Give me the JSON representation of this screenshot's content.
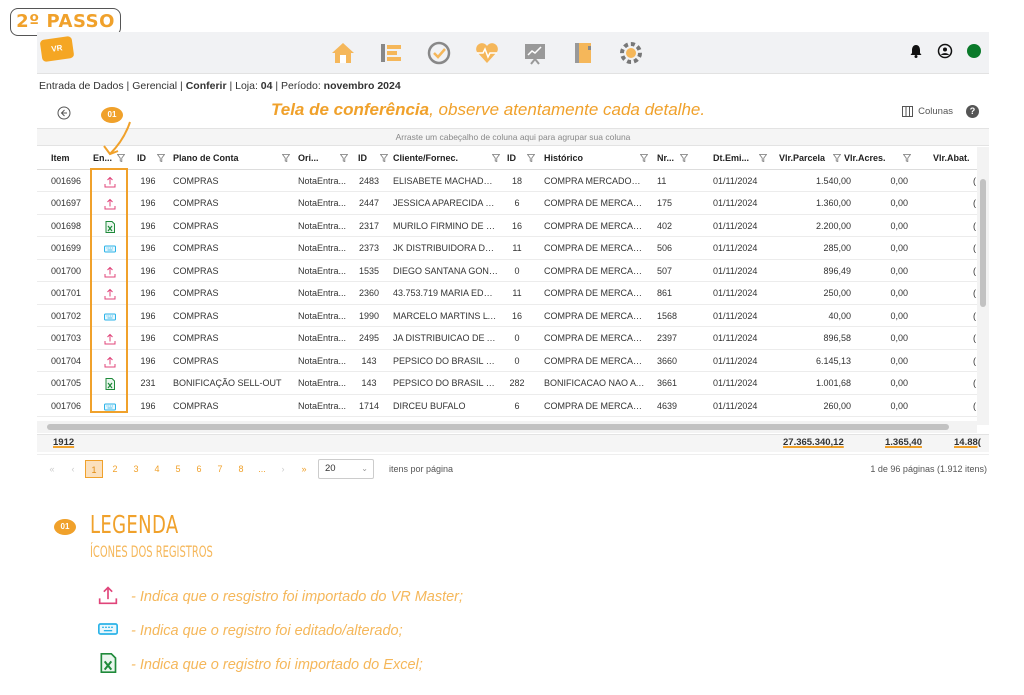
{
  "step_badge": "2º PASSO",
  "logo_text": "VR",
  "breadcrumb": {
    "part1": "Entrada de Dados | Gerencial | ",
    "module": "Conferir",
    "part2": " | Loja: ",
    "store": "04",
    "part3": " | Período: ",
    "period": "novembro 2024"
  },
  "headline": {
    "bold": "Tela de conferência",
    "rest": ", observe atentamente cada detalhe."
  },
  "columns_label": "Colunas",
  "help_label": "?",
  "group_bar_text": "Arraste um cabeçalho de coluna aqui para agrupar sua coluna",
  "callout_badge": "01",
  "grid": {
    "headers": [
      "Item",
      "En...",
      "ID",
      "Plano de Conta",
      "Ori...",
      "ID",
      "Cliente/Fornec.",
      "ID",
      "Histórico",
      "Nr...",
      "Dt.Emi...",
      "Vlr.Parcela",
      "Vlr.Acres.",
      "Vlr.Abat."
    ],
    "rows": [
      {
        "item": "001696",
        "icon": "upload-icon",
        "id1": "196",
        "plano": "COMPRAS",
        "ori": "NotaEntra...",
        "id2": "2483",
        "cliente": "ELISABETE MACHADO D...",
        "id3": "18",
        "historico": "COMPRA MERCADORIA...",
        "nr": "11",
        "dt": "01/11/2024",
        "parcela": "1.540,00",
        "acres": "0,00"
      },
      {
        "item": "001697",
        "icon": "upload-icon",
        "id1": "196",
        "plano": "COMPRAS",
        "ori": "NotaEntra...",
        "id2": "2447",
        "cliente": "JESSICA APARECIDA PER...",
        "id3": "6",
        "historico": "COMPRA DE MERCADO...",
        "nr": "175",
        "dt": "01/11/2024",
        "parcela": "1.360,00",
        "acres": "0,00"
      },
      {
        "item": "001698",
        "icon": "excel-icon",
        "id1": "196",
        "plano": "COMPRAS",
        "ori": "NotaEntra...",
        "id2": "2317",
        "cliente": "MURILO FIRMINO DE OL...",
        "id3": "16",
        "historico": "COMPRA DE MERCADO...",
        "nr": "402",
        "dt": "01/11/2024",
        "parcela": "2.200,00",
        "acres": "0,00"
      },
      {
        "item": "001699",
        "icon": "keyboard-icon",
        "id1": "196",
        "plano": "COMPRAS",
        "ori": "NotaEntra...",
        "id2": "2373",
        "cliente": "JK DISTRIBUIDORA DE H...",
        "id3": "11",
        "historico": "COMPRA DE MERCADO...",
        "nr": "506",
        "dt": "01/11/2024",
        "parcela": "285,00",
        "acres": "0,00"
      },
      {
        "item": "001700",
        "icon": "upload-icon",
        "id1": "196",
        "plano": "COMPRAS",
        "ori": "NotaEntra...",
        "id2": "1535",
        "cliente": "DIEGO SANTANA GONZ...",
        "id3": "0",
        "historico": "COMPRA DE MERCADO...",
        "nr": "507",
        "dt": "01/11/2024",
        "parcela": "896,49",
        "acres": "0,00"
      },
      {
        "item": "001701",
        "icon": "upload-icon",
        "id1": "196",
        "plano": "COMPRAS",
        "ori": "NotaEntra...",
        "id2": "2360",
        "cliente": "43.753.719 MARIA EDUA...",
        "id3": "11",
        "historico": "COMPRA DE MERCADO...",
        "nr": "861",
        "dt": "01/11/2024",
        "parcela": "250,00",
        "acres": "0,00"
      },
      {
        "item": "001702",
        "icon": "keyboard-icon",
        "id1": "196",
        "plano": "COMPRAS",
        "ori": "NotaEntra...",
        "id2": "1990",
        "cliente": "MARCELO MARTINS LTDA",
        "id3": "16",
        "historico": "COMPRA DE MERCADO...",
        "nr": "1568",
        "dt": "01/11/2024",
        "parcela": "40,00",
        "acres": "0,00"
      },
      {
        "item": "001703",
        "icon": "upload-icon",
        "id1": "196",
        "plano": "COMPRAS",
        "ori": "NotaEntra...",
        "id2": "2495",
        "cliente": "JA DISTRIBUICAO DE ALI...",
        "id3": "0",
        "historico": "COMPRA DE MERCADO...",
        "nr": "2397",
        "dt": "01/11/2024",
        "parcela": "896,58",
        "acres": "0,00"
      },
      {
        "item": "001704",
        "icon": "upload-icon",
        "id1": "196",
        "plano": "COMPRAS",
        "ori": "NotaEntra...",
        "id2": "143",
        "cliente": "PEPSICO DO BRASIL LTDA",
        "id3": "0",
        "historico": "COMPRA DE MERCADO...",
        "nr": "3660",
        "dt": "01/11/2024",
        "parcela": "6.145,13",
        "acres": "0,00"
      },
      {
        "item": "001705",
        "icon": "excel-icon",
        "id1": "231",
        "plano": "BONIFICAÇÃO SELL-OUT",
        "ori": "NotaEntra...",
        "id2": "143",
        "cliente": "PEPSICO DO BRASIL LTDA",
        "id3": "282",
        "historico": "BONIFICACAO NAO ATU...",
        "nr": "3661",
        "dt": "01/11/2024",
        "parcela": "1.001,68",
        "acres": "0,00"
      },
      {
        "item": "001706",
        "icon": "keyboard-icon",
        "id1": "196",
        "plano": "COMPRAS",
        "ori": "NotaEntra...",
        "id2": "1714",
        "cliente": "DIRCEU BUFALO",
        "id3": "6",
        "historico": "COMPRA DE MERCADO...",
        "nr": "4639",
        "dt": "01/11/2024",
        "parcela": "260,00",
        "acres": "0,00"
      }
    ]
  },
  "summary": {
    "count": "1912",
    "parcela": "27.365.340,12",
    "acres": "1.365,40",
    "abat": "14.88("
  },
  "pager": {
    "first": "«",
    "prev": "‹",
    "pages": [
      "1",
      "2",
      "3",
      "4",
      "5",
      "6",
      "7",
      "8",
      "..."
    ],
    "next": "›",
    "last": "»",
    "page_size": "20",
    "page_size_label": "itens por página",
    "info": "1 de 96 páginas (1.912 itens)"
  },
  "legend": {
    "badge": "01",
    "title": "LEGENDA",
    "subtitle": "ÍCONES DOS REGISTROS",
    "items": [
      {
        "icon": "upload-icon",
        "text": "- Indica que o resgistro foi importado do VR Master;"
      },
      {
        "icon": "keyboard-icon",
        "text": "- Indica que o registro foi editado/alterado;"
      },
      {
        "icon": "excel-icon",
        "text": "- Indica que o registro foi importado do Excel;"
      }
    ]
  },
  "colors": {
    "accent": "#f0a12b",
    "upload": "#e0447a",
    "keyboard": "#2bb3e8",
    "excel": "#1f8a3a",
    "status_online": "#0a7a2a"
  }
}
